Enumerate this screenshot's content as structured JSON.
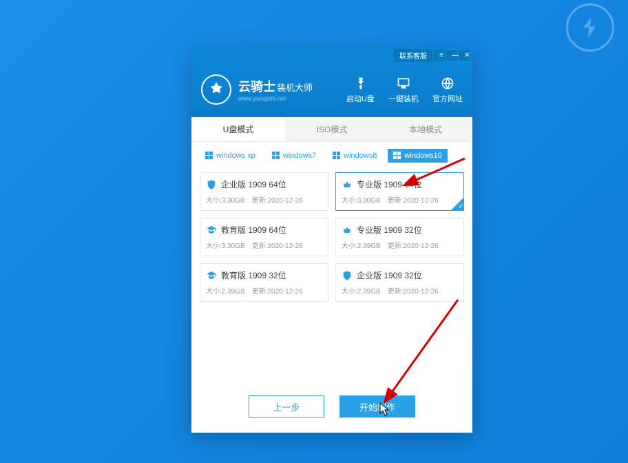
{
  "titlebar": {
    "contact": "联系客服",
    "menu": "≡",
    "min": "—",
    "close": "✕"
  },
  "brand": {
    "title": "云骑士",
    "title_suffix": "装机大师",
    "subtitle": "www.yunqishi.net"
  },
  "nav": [
    {
      "id": "usb",
      "label": "启动U盘"
    },
    {
      "id": "oneclick",
      "label": "一键装机"
    },
    {
      "id": "site",
      "label": "官方网址"
    }
  ],
  "modes": [
    {
      "id": "usb",
      "label": "U盘模式",
      "active": true
    },
    {
      "id": "iso",
      "label": "ISO模式",
      "active": false
    },
    {
      "id": "local",
      "label": "本地模式",
      "active": false
    }
  ],
  "os_tabs": [
    {
      "id": "xp",
      "label": "windows xp",
      "active": false
    },
    {
      "id": "win7",
      "label": "windows7",
      "active": false
    },
    {
      "id": "win8",
      "label": "windows8",
      "active": false
    },
    {
      "id": "win10",
      "label": "windows10",
      "active": true
    }
  ],
  "cards": [
    {
      "icon": "shield",
      "title": "企业版 1909 64位",
      "size": "大小:3.30GB",
      "updated": "更新:2020-12-26",
      "selected": false
    },
    {
      "icon": "crown",
      "title": "专业版 1909 64位",
      "size": "大小:3.30GB",
      "updated": "更新:2020-12-26",
      "selected": true
    },
    {
      "icon": "cap",
      "title": "教育版 1909 64位",
      "size": "大小:3.30GB",
      "updated": "更新:2020-12-26",
      "selected": false
    },
    {
      "icon": "crown",
      "title": "专业版 1909 32位",
      "size": "大小:2.39GB",
      "updated": "更新:2020-12-26",
      "selected": false
    },
    {
      "icon": "cap",
      "title": "教育版 1909 32位",
      "size": "大小:2.39GB",
      "updated": "更新:2020-12-26",
      "selected": false
    },
    {
      "icon": "shield",
      "title": "企业版 1909 32位",
      "size": "大小:2.39GB",
      "updated": "更新:2020-12-26",
      "selected": false
    }
  ],
  "footer": {
    "prev": "上一步",
    "start": "开始制作"
  },
  "colors": {
    "accent": "#2aa0e8",
    "header": "#0d86d6"
  }
}
